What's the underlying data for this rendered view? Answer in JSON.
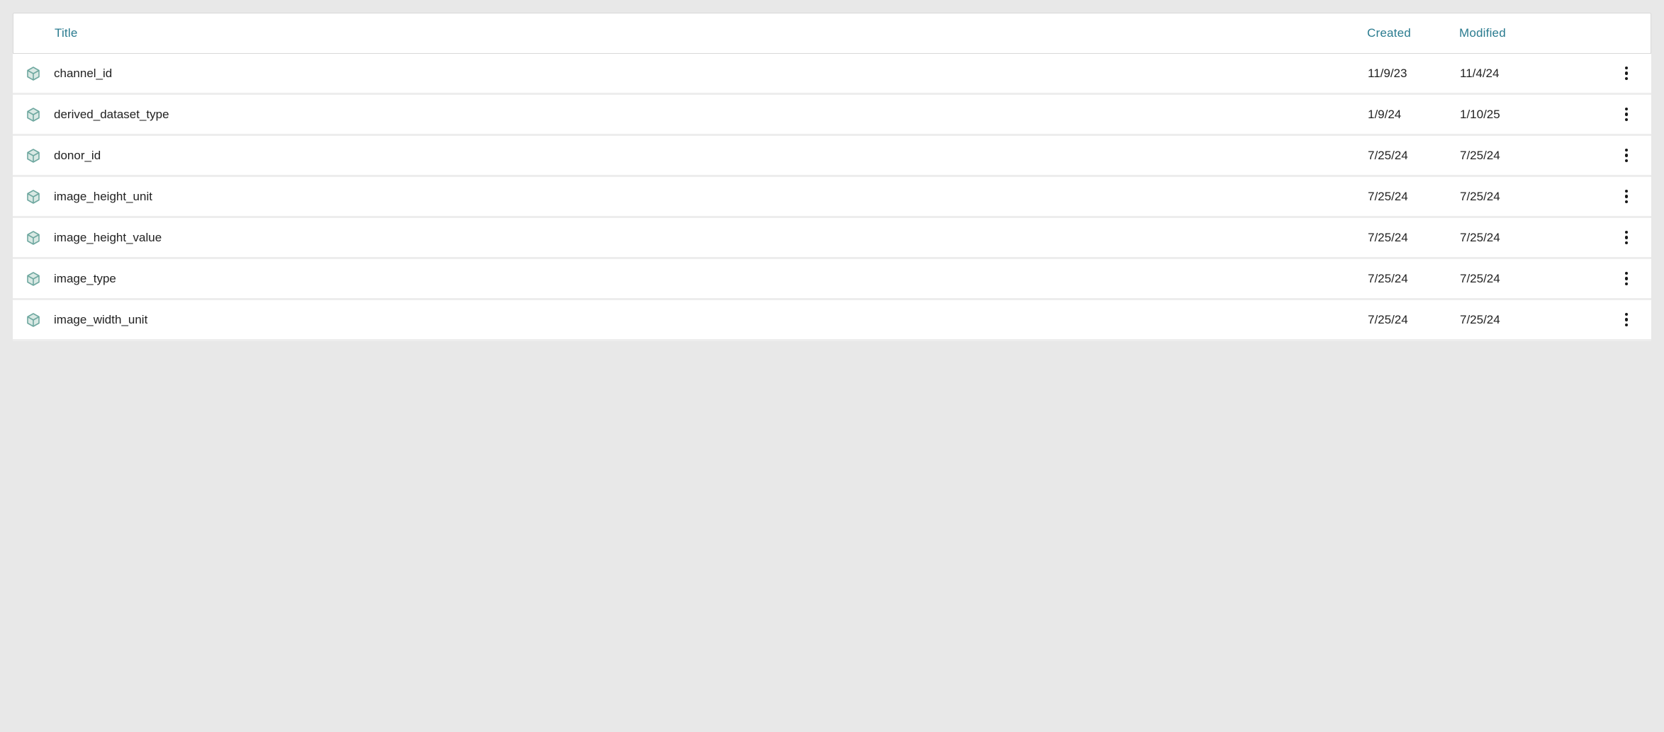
{
  "columns": {
    "title": "Title",
    "created": "Created",
    "modified": "Modified"
  },
  "rows": [
    {
      "title": "channel_id",
      "created": "11/9/23",
      "modified": "11/4/24"
    },
    {
      "title": "derived_dataset_type",
      "created": "1/9/24",
      "modified": "1/10/25"
    },
    {
      "title": "donor_id",
      "created": "7/25/24",
      "modified": "7/25/24"
    },
    {
      "title": "image_height_unit",
      "created": "7/25/24",
      "modified": "7/25/24"
    },
    {
      "title": "image_height_value",
      "created": "7/25/24",
      "modified": "7/25/24"
    },
    {
      "title": "image_type",
      "created": "7/25/24",
      "modified": "7/25/24"
    },
    {
      "title": "image_width_unit",
      "created": "7/25/24",
      "modified": "7/25/24"
    }
  ],
  "icon_name": "cube-icon",
  "accent_color": "#2a7b8f",
  "icon_stroke": "#6fa8a0",
  "icon_fill": "#d9e9e4"
}
